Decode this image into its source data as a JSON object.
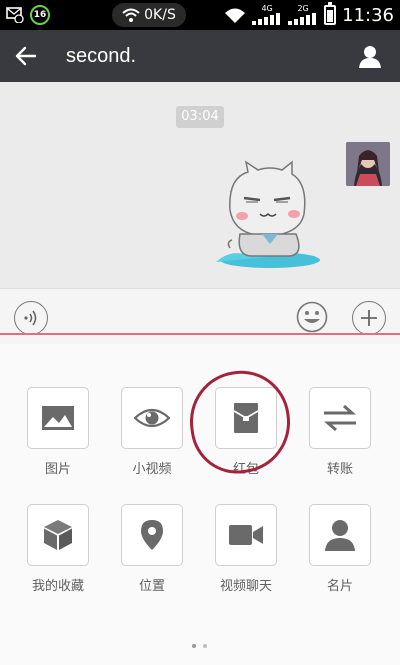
{
  "status_bar": {
    "notification_count": "16",
    "network_speed": "0K/S",
    "network_types": [
      "4G",
      "2G"
    ],
    "time": "11:36"
  },
  "header": {
    "title": "second."
  },
  "chat": {
    "timestamp": "03:04"
  },
  "tools": [
    {
      "label": "图片",
      "icon": "image-icon"
    },
    {
      "label": "小视频",
      "icon": "eye-icon"
    },
    {
      "label": "红包",
      "icon": "red-packet-icon"
    },
    {
      "label": "转账",
      "icon": "transfer-icon"
    },
    {
      "label": "我的收藏",
      "icon": "cube-icon"
    },
    {
      "label": "位置",
      "icon": "location-icon"
    },
    {
      "label": "视频聊天",
      "icon": "video-camera-icon"
    },
    {
      "label": "名片",
      "icon": "contact-card-icon"
    }
  ],
  "pager": {
    "pages": 2,
    "current": 1
  }
}
